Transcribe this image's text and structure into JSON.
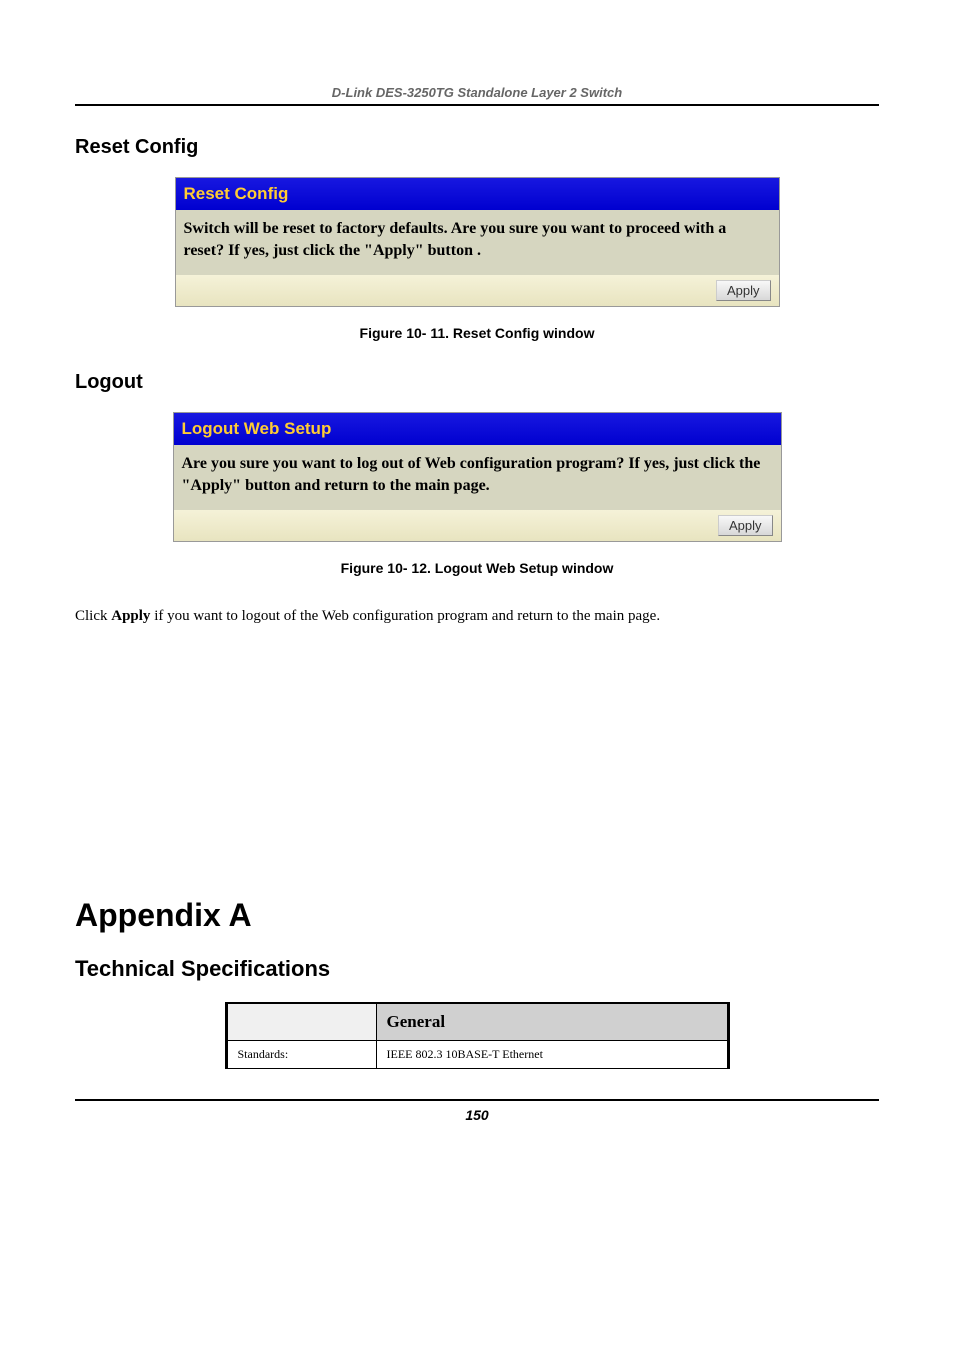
{
  "header": {
    "title": "D-Link DES-3250TG Standalone Layer 2 Switch"
  },
  "sections": {
    "resetConfig": {
      "heading": "Reset Config",
      "panelTitle": "Reset Config",
      "panelBody": "Switch will be reset to factory defaults. Are you sure you want to proceed with a reset? If yes, just click the \"Apply\" button .",
      "applyLabel": "Apply",
      "caption": "Figure 10- 11.  Reset Config window"
    },
    "logout": {
      "heading": "Logout",
      "panelTitle": "Logout Web Setup",
      "panelBody": "Are you sure you want to log out of Web configuration program? If yes, just click the \"Apply\" button and return to the main page.",
      "applyLabel": "Apply",
      "caption": "Figure 10- 12.  Logout Web Setup window",
      "paragraphPre": "Click ",
      "paragraphBold": "Apply",
      "paragraphPost": " if you want to logout of the Web configuration program and return to the main page."
    },
    "appendix": {
      "title": "Appendix A",
      "subtitle": "Technical Specifications",
      "table": {
        "headerCell1": "",
        "headerCell2": "General",
        "rowLabel": "Standards:",
        "rowValue": "IEEE 802.3 10BASE-T Ethernet"
      }
    }
  },
  "footer": {
    "pageNumber": "150"
  }
}
